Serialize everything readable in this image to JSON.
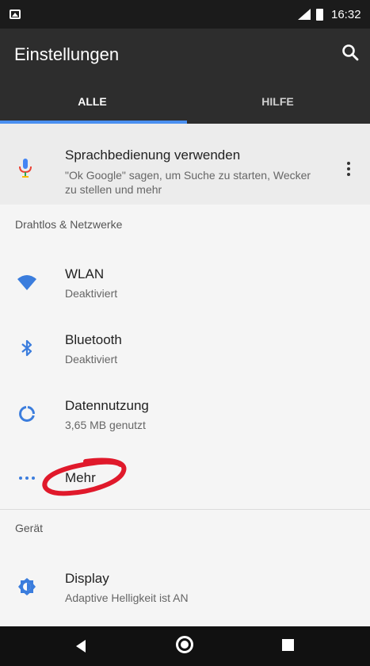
{
  "status_bar": {
    "time": "16:32"
  },
  "app_bar": {
    "title": "Einstellungen",
    "tabs": [
      {
        "label": "ALLE",
        "selected": true
      },
      {
        "label": "HILFE",
        "selected": false
      }
    ]
  },
  "suggestion": {
    "title": "Sprachbedienung verwenden",
    "summary": "\"Ok Google\" sagen, um Suche zu starten, Wecker zu stellen und mehr",
    "icon": "mic-icon"
  },
  "sections": [
    {
      "category": "Drahtlos & Netzwerke",
      "items": [
        {
          "label": "WLAN",
          "summary": "Deaktiviert",
          "icon": "wifi-icon"
        },
        {
          "label": "Bluetooth",
          "summary": "Deaktiviert",
          "icon": "bluetooth-icon"
        },
        {
          "label": "Datennutzung",
          "summary": "3,65 MB genutzt",
          "icon": "data-usage-icon"
        },
        {
          "label": "Mehr",
          "summary": "",
          "icon": "more-horiz-icon"
        }
      ]
    },
    {
      "category": "Gerät",
      "items": [
        {
          "label": "Display",
          "summary": "Adaptive Helligkeit ist AN",
          "icon": "brightness-icon"
        }
      ]
    }
  ],
  "colors": {
    "accent": "#4a8ff0",
    "appbar": "#2d2d2d",
    "statusbar": "#1b1b1b",
    "annotation": "#e0192b"
  }
}
